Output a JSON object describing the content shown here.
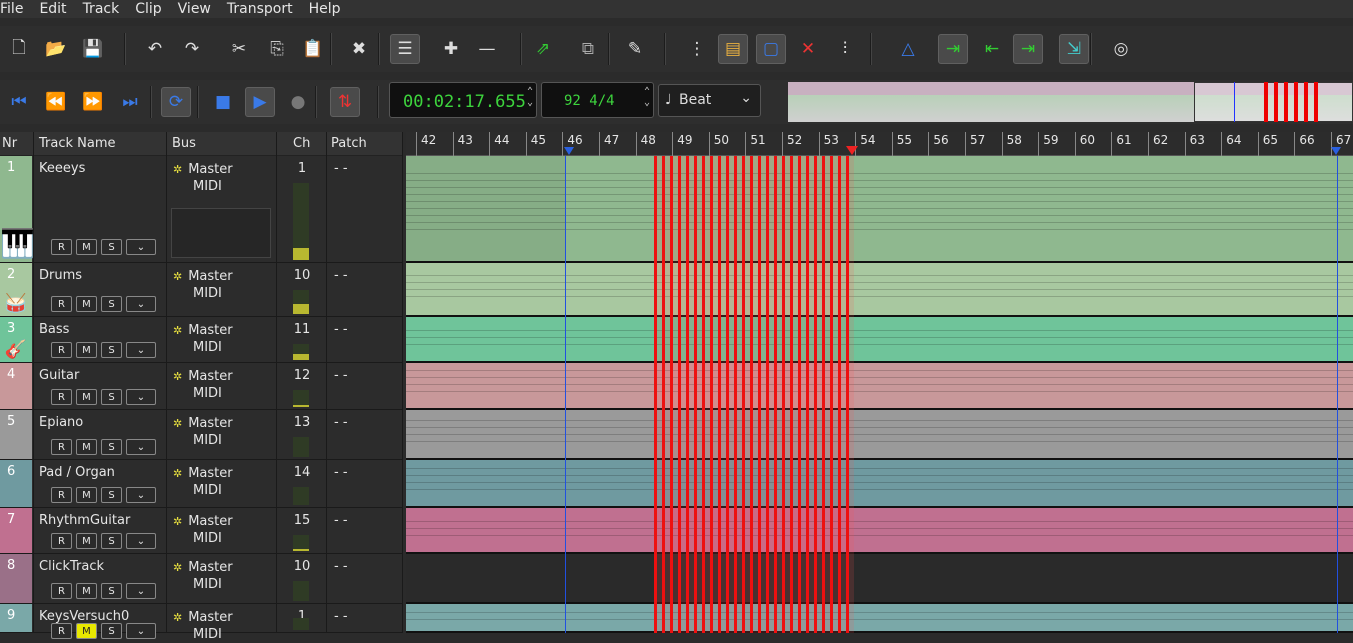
{
  "menu": [
    "File",
    "Edit",
    "Track",
    "Clip",
    "View",
    "Transport",
    "Help"
  ],
  "toolbar": {
    "icons": [
      "new-file-icon",
      "open-folder-icon",
      "save-icon",
      "undo-icon",
      "redo-icon",
      "cut-icon",
      "copy-icon",
      "paste-icon",
      "delete-icon",
      "arrange-icon",
      "add-track-icon",
      "remove-track-icon",
      "split-icon",
      "duplicate-track-icon",
      "edit-icon",
      "tree-icon",
      "folder-icon",
      "select-icon",
      "split-cursor-icon",
      "mixer-icon",
      "tempo-icon",
      "jump-start-icon",
      "jump-marker-icon",
      "jump-end-icon",
      "export-icon",
      "about-icon"
    ]
  },
  "transport": {
    "time": "00:02:17.655",
    "tempo": "92 4/4",
    "snap": "Beat",
    "snap_glyph": "♩"
  },
  "headers": {
    "nr": "Nr",
    "name": "Track Name",
    "bus": "Bus",
    "ch": "Ch",
    "patch": "Patch"
  },
  "bus_icon": "✲",
  "tracks": [
    {
      "nr": "1",
      "name": "Keeeys",
      "bus1": "Master",
      "bus2": "MIDI",
      "ch": "1",
      "patch": "- -",
      "color": "#8fb88f",
      "level": 0.15,
      "icon": "piano-icon"
    },
    {
      "nr": "2",
      "name": "Drums",
      "bus1": "Master",
      "bus2": "MIDI",
      "ch": "10",
      "patch": "- -",
      "color": "#a8c8a0",
      "level": 0.4,
      "icon": "drums-icon"
    },
    {
      "nr": "3",
      "name": "Bass",
      "bus1": "Master",
      "bus2": "MIDI",
      "ch": "11",
      "patch": "- -",
      "color": "#6fc49a",
      "level": 0.35,
      "icon": "guitar-icon"
    },
    {
      "nr": "4",
      "name": "Guitar",
      "bus1": "Master",
      "bus2": "MIDI",
      "ch": "12",
      "patch": "- -",
      "color": "#c8989a",
      "level": 0.1
    },
    {
      "nr": "5",
      "name": "Epiano",
      "bus1": "Master",
      "bus2": "MIDI",
      "ch": "13",
      "patch": "- -",
      "color": "#9a9a9a",
      "level": 0.0
    },
    {
      "nr": "6",
      "name": "Pad / Organ",
      "bus1": "Master",
      "bus2": "MIDI",
      "ch": "14",
      "patch": "- -",
      "color": "#6f9aa0",
      "level": 0.0
    },
    {
      "nr": "7",
      "name": "RhythmGuitar",
      "bus1": "Master",
      "bus2": "MIDI",
      "ch": "15",
      "patch": "- -",
      "color": "#c07090",
      "level": 0.1
    },
    {
      "nr": "8",
      "name": "ClickTrack",
      "bus1": "Master",
      "bus2": "MIDI",
      "ch": "10",
      "patch": "- -",
      "color": "#2a2a2a",
      "level": 0.0
    },
    {
      "nr": "9",
      "name": "KeysVersuch0",
      "bus1": "Master",
      "bus2": "MIDI",
      "ch": "1",
      "patch": "- -",
      "color": "#7aa8a8",
      "level": 0.0
    }
  ],
  "ruler": [
    "42",
    "43",
    "44",
    "45",
    "46",
    "47",
    "48",
    "49",
    "50",
    "51",
    "52",
    "53",
    "54",
    "55",
    "56",
    "57",
    "58",
    "59",
    "60",
    "61",
    "62",
    "63",
    "64",
    "65",
    "66",
    "67"
  ],
  "buttons": {
    "r": "R",
    "m": "M",
    "s": "S",
    "dd": "⌄"
  }
}
